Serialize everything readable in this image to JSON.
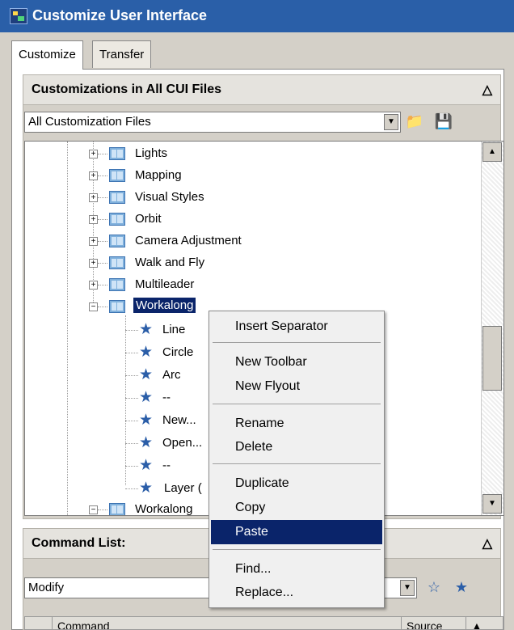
{
  "window": {
    "title": "Customize User Interface"
  },
  "tabs": [
    {
      "label": "Customize"
    },
    {
      "label": "Transfer"
    }
  ],
  "customizations": {
    "header": "Customizations in All CUI Files",
    "filter_value": "All Customization Files",
    "icons": [
      "open-folder-icon",
      "save-icon"
    ],
    "tree": [
      {
        "label": "Lights"
      },
      {
        "label": "Mapping"
      },
      {
        "label": "Visual Styles"
      },
      {
        "label": "Orbit"
      },
      {
        "label": "Camera Adjustment"
      },
      {
        "label": "Walk and Fly"
      },
      {
        "label": "Multileader"
      },
      {
        "label": "Workalong"
      },
      {
        "label": "Line"
      },
      {
        "label": "Circle"
      },
      {
        "label": "Arc"
      },
      {
        "label": "--"
      },
      {
        "label": "New..."
      },
      {
        "label": "Open..."
      },
      {
        "label": "--"
      },
      {
        "label": "Layer ("
      },
      {
        "label": "Workalong"
      }
    ]
  },
  "context_menu": {
    "items": [
      {
        "label": "Insert Separator"
      },
      {
        "label": "New Toolbar"
      },
      {
        "label": "New Flyout"
      },
      {
        "label": "Rename"
      },
      {
        "label": "Delete"
      },
      {
        "label": "Duplicate"
      },
      {
        "label": "Copy"
      },
      {
        "label": "Paste"
      },
      {
        "label": "Find..."
      },
      {
        "label": "Replace..."
      }
    ],
    "highlighted": "Paste"
  },
  "command_list": {
    "header": "Command List:",
    "filter_value": "Modify",
    "icons": [
      "star-icon",
      "new-command-icon"
    ],
    "columns": [
      {
        "label": "Command"
      },
      {
        "label": "Source"
      }
    ]
  },
  "colors": {
    "title_bar": "#2a5fa8",
    "selection": "#0a246a",
    "command_star": "#2b5ea8"
  }
}
